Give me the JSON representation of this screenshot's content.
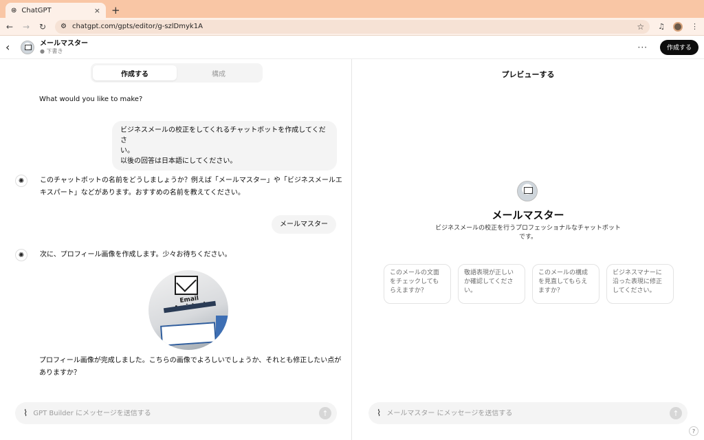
{
  "browser": {
    "tab_title": "ChatGPT",
    "tab_close": "×",
    "new_tab": "+",
    "url": "chatgpt.com/gpts/editor/g-szlDmyk1A"
  },
  "header": {
    "gpt_name": "メールマスター",
    "status": "● 下書き",
    "more": "···",
    "create_button": "作成する"
  },
  "builder": {
    "tabs": [
      "作成する",
      "構成"
    ],
    "messages": {
      "prompt": "What would you like to make?",
      "user_1_line1": "ビジネスメールの校正をしてくれるチャットボットを作成してくださ",
      "user_1_line2": "い。",
      "user_1_line3": "以後の回答は日本語にしてください。",
      "bot_1": "このチャットボットの名前をどうしましょうか？例えば「メールマスター」や「ビジネスメールエキスパート」などがあります。おすすめの名前を教えてください。",
      "user_2": "メールマスター",
      "bot_2": "次に、プロフィール画像を作成します。少々お待ちください。",
      "bot_3": "プロフィール画像が完成しました。こちらの画像でよろしいでしょうか、それとも修正したい点がありますか？"
    },
    "profile_image_text": "Email Assistant",
    "composer_placeholder": "GPT Builder にメッセージを送信する"
  },
  "preview": {
    "title": "プレビューする",
    "name": "メールマスター",
    "description": "ビジネスメールの校正を行うプロフェッショナルなチャットボットです。",
    "starters": [
      "このメールの文面をチェックしてもらえますか？",
      "敬語表現が正しいか確認してください。",
      "このメールの構成を見直してもらえますか？",
      "ビジネスマナーに沿った表現に修正してください。"
    ],
    "composer_placeholder": "メールマスター にメッセージを送信する",
    "help": "?"
  }
}
